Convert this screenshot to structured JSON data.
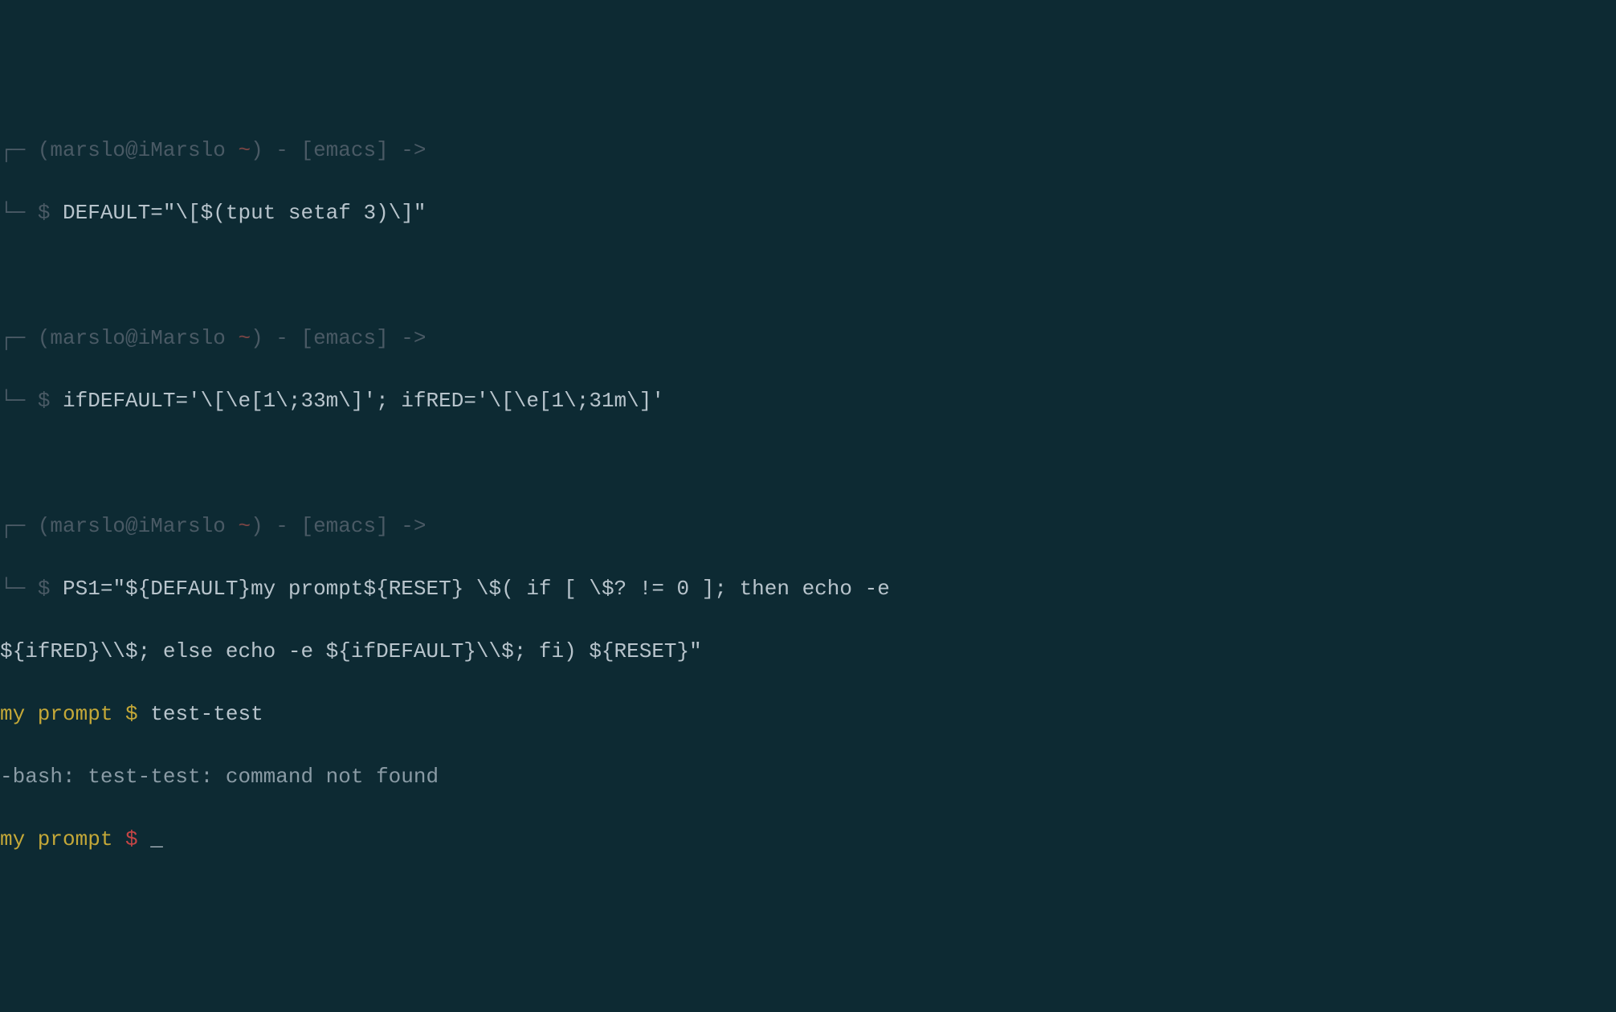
{
  "blocks": [
    {
      "prompt": {
        "bracket_top": "┌─ ",
        "user_host": "(marslo@iMarslo ",
        "tilde": "~",
        "closing": ") - [emacs] ->",
        "bracket_bottom": "└─ ",
        "dollar": "$"
      },
      "command": "DEFAULT=\"\\[$(tput setaf 3)\\]\""
    },
    {
      "prompt": {
        "bracket_top": "┌─ ",
        "user_host": "(marslo@iMarslo ",
        "tilde": "~",
        "closing": ") - [emacs] ->",
        "bracket_bottom": "└─ ",
        "dollar": "$"
      },
      "command": "ifDEFAULT='\\[\\e[1\\;33m\\]'; ifRED='\\[\\e[1\\;31m\\]'"
    },
    {
      "prompt": {
        "bracket_top": "┌─ ",
        "user_host": "(marslo@iMarslo ",
        "tilde": "~",
        "closing": ") - [emacs] ->",
        "bracket_bottom": "└─ ",
        "dollar": "$"
      },
      "command_line1": "PS1=\"${DEFAULT}my prompt${RESET} \\$( if [ \\$? != 0 ]; then echo -e ",
      "command_line2": "${ifRED}\\\\$; else echo -e ${ifDEFAULT}\\\\$; fi) ${RESET}\""
    }
  ],
  "output": {
    "prompt1_text": "my prompt ",
    "prompt1_dollar": "$",
    "cmd1": " test-test",
    "error": "-bash: test-test: command not found",
    "prompt2_text": "my prompt ",
    "prompt2_dollar": "$",
    "cursor": " _"
  }
}
